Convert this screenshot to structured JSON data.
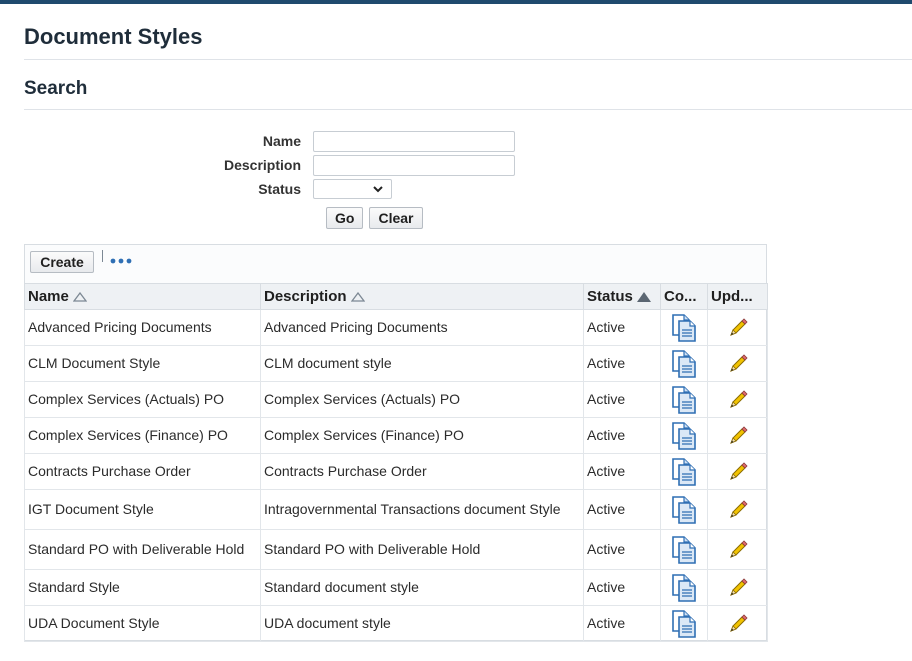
{
  "page": {
    "title": "Document Styles"
  },
  "search": {
    "title": "Search",
    "name_label": "Name",
    "description_label": "Description",
    "status_label": "Status",
    "name_value": "",
    "description_value": "",
    "status_value": "",
    "go_label": "Go",
    "clear_label": "Clear"
  },
  "toolbar": {
    "create_label": "Create"
  },
  "table": {
    "headers": {
      "name": "Name",
      "description": "Description",
      "status": "Status",
      "copy": "Co...",
      "update": "Upd..."
    },
    "rows": [
      {
        "name": "Advanced Pricing Documents",
        "description": "Advanced Pricing Documents",
        "status": "Active"
      },
      {
        "name": "CLM Document Style",
        "description": "CLM document style",
        "status": "Active"
      },
      {
        "name": "Complex Services (Actuals) PO",
        "description": "Complex Services (Actuals) PO",
        "status": "Active"
      },
      {
        "name": "Complex Services (Finance) PO",
        "description": "Complex Services (Finance) PO",
        "status": "Active"
      },
      {
        "name": "Contracts Purchase Order",
        "description": "Contracts Purchase Order",
        "status": "Active"
      },
      {
        "name": "IGT Document Style",
        "description": "Intragovernmental Transactions document Style",
        "status": "Active"
      },
      {
        "name": "Standard PO with Deliverable Hold",
        "description": "Standard PO with Deliverable Hold",
        "status": "Active"
      },
      {
        "name": "Standard Style",
        "description": "Standard document style",
        "status": "Active"
      },
      {
        "name": "UDA Document Style",
        "description": "UDA document style",
        "status": "Active"
      }
    ]
  },
  "icons": {
    "copy": "duplicate-icon",
    "update": "pencil-icon",
    "more": "more-horizontal-icon",
    "sort": "sort-triangle-icon"
  },
  "colors": {
    "brand_bar": "#1f4a6e",
    "icon_blue": "#2f6fb4",
    "pencil_yellow": "#f2c300"
  }
}
